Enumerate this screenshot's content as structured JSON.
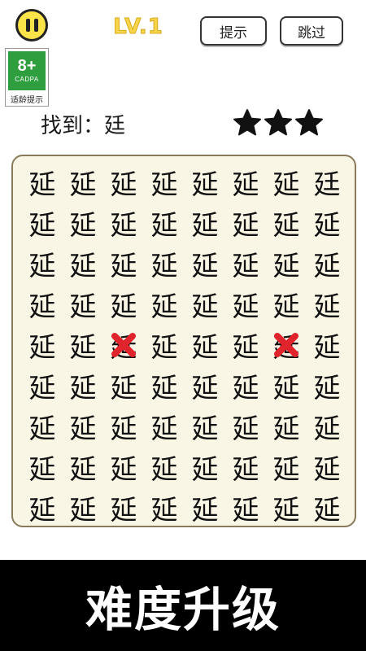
{
  "header": {
    "level": "LV.1",
    "hint_label": "提示",
    "skip_label": "跳过"
  },
  "age_rating": {
    "age": "8+",
    "org": "CADPA",
    "tip": "适龄提示",
    "color": "#2f9e3e"
  },
  "task": {
    "label": "找到：廷",
    "stars": 3
  },
  "grid": {
    "rows": [
      [
        "延",
        "延",
        "延",
        "延",
        "延",
        "延",
        "延",
        "廷"
      ],
      [
        "延",
        "延",
        "延",
        "延",
        "延",
        "延",
        "延",
        "延"
      ],
      [
        "延",
        "延",
        "延",
        "延",
        "延",
        "延",
        "延",
        "延"
      ],
      [
        "延",
        "延",
        "延",
        "延",
        "延",
        "延",
        "延",
        "延"
      ],
      [
        "延",
        "延",
        "延",
        "延",
        "延",
        "延",
        "延",
        "延"
      ],
      [
        "延",
        "延",
        "延",
        "延",
        "延",
        "延",
        "延",
        "延"
      ],
      [
        "延",
        "延",
        "延",
        "延",
        "延",
        "延",
        "延",
        "延"
      ],
      [
        "延",
        "延",
        "延",
        "延",
        "延",
        "延",
        "延",
        "延"
      ],
      [
        "延",
        "延",
        "延",
        "延",
        "延",
        "延",
        "延",
        "延"
      ]
    ],
    "wrong_marks": [
      [
        4,
        2
      ],
      [
        4,
        6
      ]
    ],
    "mark_color": "#e0242b"
  },
  "banner": {
    "text": "难度升级"
  }
}
